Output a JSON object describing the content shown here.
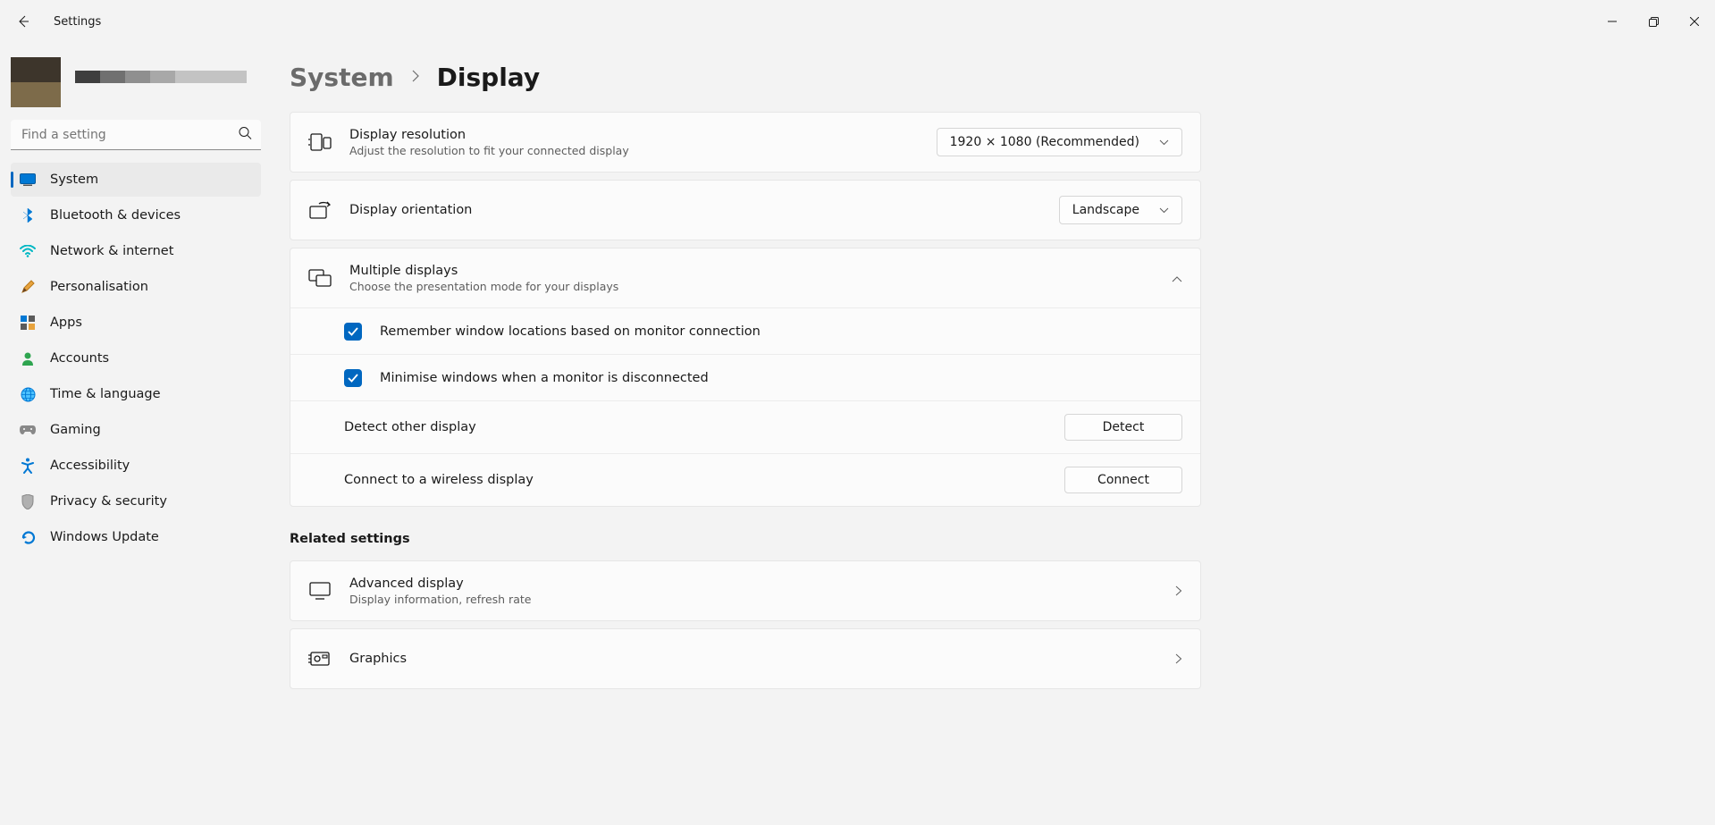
{
  "window": {
    "title": "Settings"
  },
  "search": {
    "placeholder": "Find a setting"
  },
  "sidebar": {
    "items": [
      {
        "label": "System"
      },
      {
        "label": "Bluetooth & devices"
      },
      {
        "label": "Network & internet"
      },
      {
        "label": "Personalisation"
      },
      {
        "label": "Apps"
      },
      {
        "label": "Accounts"
      },
      {
        "label": "Time & language"
      },
      {
        "label": "Gaming"
      },
      {
        "label": "Accessibility"
      },
      {
        "label": "Privacy & security"
      },
      {
        "label": "Windows Update"
      }
    ]
  },
  "breadcrumb": {
    "parent": "System",
    "current": "Display"
  },
  "resolution": {
    "title": "Display resolution",
    "subtitle": "Adjust the resolution to fit your connected display",
    "value": "1920 × 1080 (Recommended)"
  },
  "orientation": {
    "title": "Display orientation",
    "value": "Landscape"
  },
  "multiple": {
    "title": "Multiple displays",
    "subtitle": "Choose the presentation mode for your displays",
    "remember": "Remember window locations based on monitor connection",
    "minimise": "Minimise windows when a monitor is disconnected",
    "detect_label": "Detect other display",
    "detect_btn": "Detect",
    "connect_label": "Connect to a wireless display",
    "connect_btn": "Connect"
  },
  "related": {
    "header": "Related settings",
    "advanced": {
      "title": "Advanced display",
      "subtitle": "Display information, refresh rate"
    },
    "graphics": {
      "title": "Graphics"
    }
  }
}
